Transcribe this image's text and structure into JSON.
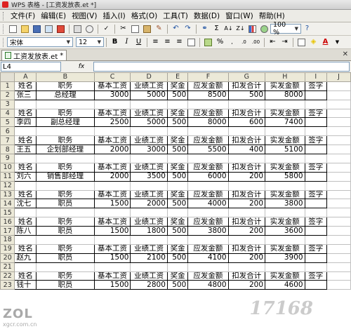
{
  "title_bar": {
    "text": "WPS 表格 - [工资发放表.et *]"
  },
  "menu": [
    "文件(F)",
    "编辑(E)",
    "视图(V)",
    "插入(I)",
    "格式(O)",
    "工具(T)",
    "数据(D)",
    "窗口(W)",
    "帮助(H)"
  ],
  "toolbar": {
    "zoom": "100 %",
    "font_name": "宋体",
    "font_size": "12",
    "bold": "B",
    "italic": "I",
    "underline": "U",
    "sum": "Σ",
    "percent": "%",
    "font_color_label": "A"
  },
  "doc_tab": {
    "name": "工资发放表.et",
    "close": "✕",
    "dirty": "*"
  },
  "formula_bar": {
    "cell_ref": "L4",
    "fx": "fx"
  },
  "columns": [
    "A",
    "B",
    "C",
    "D",
    "E",
    "F",
    "G",
    "H",
    "I",
    "J"
  ],
  "header_labels": [
    "姓名",
    "职务",
    "基本工资",
    "业绩工资",
    "奖金",
    "应发金额",
    "扣发合计",
    "实发金额",
    "签字"
  ],
  "rows": [
    {
      "r": "1",
      "type": "header"
    },
    {
      "r": "2",
      "type": "data",
      "name": "张三",
      "title": "总经理",
      "base": "3000",
      "perf": "5000",
      "bonus": "500",
      "gross": "8500",
      "deduct": "500",
      "net": "8000"
    },
    {
      "r": "3",
      "type": "blank"
    },
    {
      "r": "4",
      "type": "header"
    },
    {
      "r": "5",
      "type": "data",
      "name": "李四",
      "title": "副总经理",
      "base": "2500",
      "perf": "5000",
      "bonus": "500",
      "gross": "8000",
      "deduct": "600",
      "net": "7400"
    },
    {
      "r": "6",
      "type": "blank"
    },
    {
      "r": "7",
      "type": "header"
    },
    {
      "r": "8",
      "type": "data",
      "name": "王五",
      "title": "企划部经理",
      "base": "2000",
      "perf": "3000",
      "bonus": "500",
      "gross": "5500",
      "deduct": "400",
      "net": "5100"
    },
    {
      "r": "9",
      "type": "blank"
    },
    {
      "r": "10",
      "type": "header"
    },
    {
      "r": "11",
      "type": "data",
      "name": "刘六",
      "title": "销售部经理",
      "base": "2000",
      "perf": "3500",
      "bonus": "500",
      "gross": "6000",
      "deduct": "200",
      "net": "5800"
    },
    {
      "r": "12",
      "type": "blank"
    },
    {
      "r": "13",
      "type": "header"
    },
    {
      "r": "14",
      "type": "data",
      "name": "沈七",
      "title": "职员",
      "base": "1500",
      "perf": "2000",
      "bonus": "500",
      "gross": "4000",
      "deduct": "200",
      "net": "3800"
    },
    {
      "r": "15",
      "type": "blank"
    },
    {
      "r": "16",
      "type": "header"
    },
    {
      "r": "17",
      "type": "data",
      "name": "陈八",
      "title": "职员",
      "base": "1500",
      "perf": "1800",
      "bonus": "500",
      "gross": "3800",
      "deduct": "200",
      "net": "3600"
    },
    {
      "r": "18",
      "type": "blank"
    },
    {
      "r": "19",
      "type": "header"
    },
    {
      "r": "20",
      "type": "data",
      "name": "赵九",
      "title": "职员",
      "base": "1500",
      "perf": "2100",
      "bonus": "500",
      "gross": "4100",
      "deduct": "200",
      "net": "3900"
    },
    {
      "r": "21",
      "type": "blank"
    },
    {
      "r": "22",
      "type": "header"
    },
    {
      "r": "23",
      "type": "data",
      "name": "钱十",
      "title": "职员",
      "base": "1500",
      "perf": "2800",
      "bonus": "500",
      "gross": "4800",
      "deduct": "200",
      "net": "4600"
    }
  ],
  "watermark_left": {
    "text": "ZOL",
    "sub": "xgcr.com.cn"
  },
  "watermark_right": {
    "text": "17168"
  }
}
